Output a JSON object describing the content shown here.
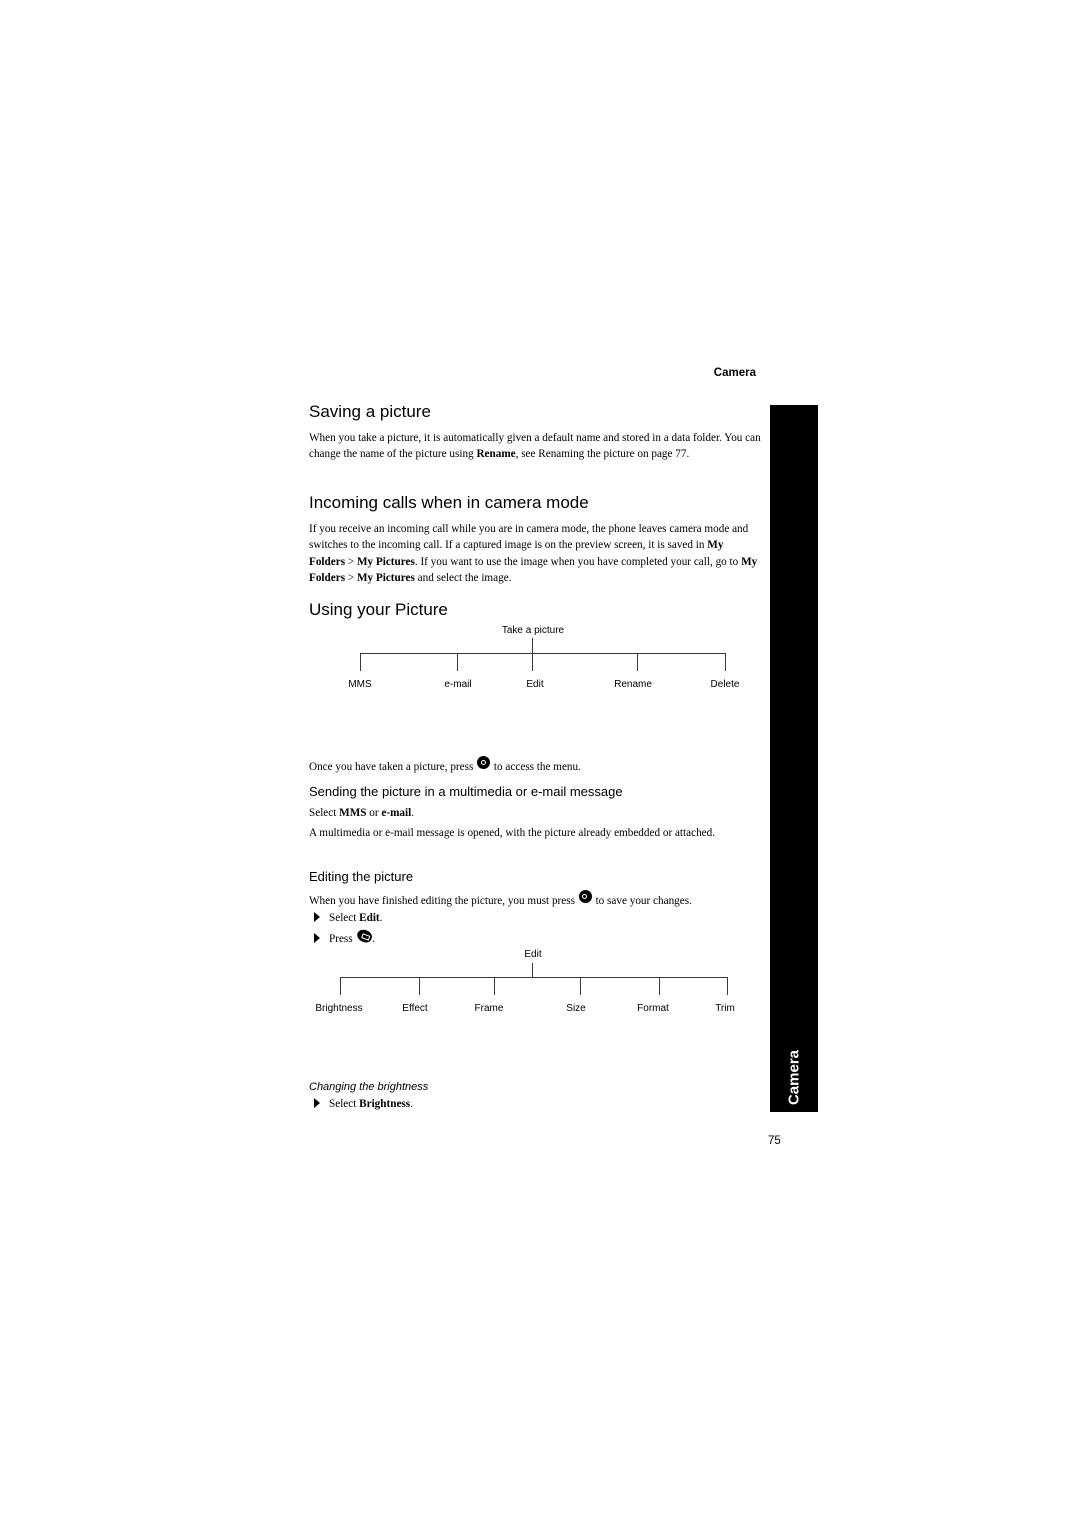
{
  "running_head": "Camera",
  "side_tab": "Camera",
  "page_number": "75",
  "sections": {
    "saving": {
      "title": "Saving a picture",
      "body_parts": [
        "When you take a picture, it is automatically given a default name and stored in a data folder. You can change the name of the picture using ",
        "Rename",
        ", see Renaming the picture on page 77."
      ]
    },
    "incoming": {
      "title": "Incoming calls when in camera mode",
      "body_parts": [
        "If you receive an incoming call while you are in camera mode, the phone leaves camera mode and switches to the incoming call. If a captured image is on the preview screen, it is saved in ",
        "My Folders",
        " > ",
        "My Pictures",
        ". If you want to use the image when you have completed your call, go to ",
        "My Folders",
        " > ",
        "My Pictures",
        " and select the image."
      ]
    },
    "using": {
      "title": "Using your Picture",
      "menu_diagram": {
        "root": "Take a picture",
        "children": [
          "MMS",
          "e-mail",
          "Edit",
          "Rename",
          "Delete"
        ]
      },
      "instruction_before": "Once you have taken a picture, press ",
      "instruction_icon": "ok-key-icon",
      "instruction_after": " to access the menu."
    },
    "sending": {
      "title": "Sending the picture in a multimedia or e-mail message",
      "select_parts": [
        "Select ",
        "MMS",
        " or ",
        "e-mail",
        "."
      ],
      "body": "A multimedia or e-mail message is opened, with the picture already embedded or attached."
    },
    "editing": {
      "title": "Editing the picture",
      "intro_before": "When you have finished editing the picture, you must press ",
      "intro_icon": "ok-key-icon",
      "intro_after": " to save your changes.",
      "steps": [
        {
          "parts": [
            "Select ",
            "Edit",
            "."
          ]
        },
        {
          "parts": [
            "Press ",
            "."
          ],
          "icon": "soft-key-icon"
        }
      ],
      "menu_diagram": {
        "root": "Edit",
        "children": [
          "Brightness",
          "Effect",
          "Frame",
          "Size",
          "Format",
          "Trim"
        ]
      }
    },
    "brightness": {
      "title": "Changing the brightness",
      "steps": [
        {
          "parts": [
            "Select ",
            "Brightness",
            "."
          ]
        }
      ]
    }
  }
}
